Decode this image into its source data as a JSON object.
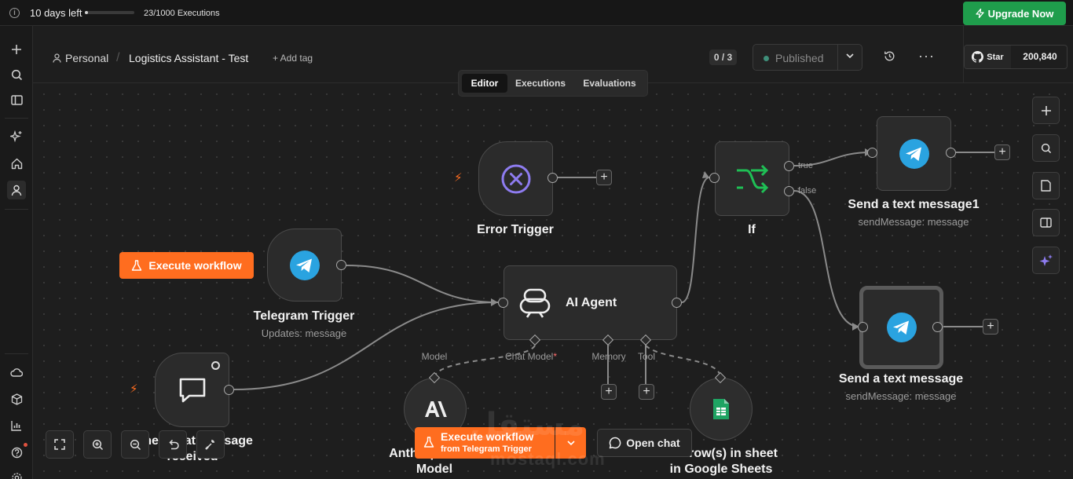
{
  "banner": {
    "days_left": "10 days left",
    "executions": "23/1000 Executions",
    "executions_used_fraction": 0.023,
    "upgrade": "Upgrade Now"
  },
  "header": {
    "project": "Personal",
    "workflow_name": "Logistics Assistant - Test",
    "add_tag": "+ Add tag",
    "counter": "0 / 3",
    "published": "Published",
    "github_star": "Star",
    "github_count": "200,840"
  },
  "tabs": [
    "Editor",
    "Executions",
    "Evaluations"
  ],
  "active_tab": "Editor",
  "nodes": {
    "error_trigger": {
      "title": "Error Trigger"
    },
    "telegram_trigger": {
      "title": "Telegram Trigger",
      "subtitle": "Updates: message"
    },
    "chat_trigger": {
      "title_line1": "When chat message",
      "title_line2": "received"
    },
    "ai_agent": {
      "title": "AI Agent",
      "ports": [
        "Chat Model",
        "Memory",
        "Tool"
      ],
      "required_mark": "*"
    },
    "model": {
      "label": "Model",
      "title_line1": "Anthropic Chat",
      "title_line2": "Model"
    },
    "sheets": {
      "title_line1": "Get row(s) in sheet",
      "title_line2": "in Google Sheets"
    },
    "if": {
      "title": "If",
      "true_label": "true",
      "false_label": "false"
    },
    "send1": {
      "title": "Send a text message1",
      "subtitle": "sendMessage: message"
    },
    "send2": {
      "title": "Send a text message",
      "subtitle": "sendMessage: message"
    }
  },
  "canvas_buttons": {
    "execute_workflow": "Execute workflow",
    "execute_main": "Execute workflow",
    "execute_from": "from Telegram Trigger",
    "open_chat": "Open chat"
  },
  "watermark": {
    "arabic": "مستقل",
    "latin": "mostaql.com"
  },
  "colors": {
    "accent_orange": "#ff6d1f",
    "upgrade_green": "#1f9d4c",
    "telegram_blue": "#2aa3e0",
    "if_green": "#1fbf55",
    "error_purple": "#8e7cf0"
  }
}
